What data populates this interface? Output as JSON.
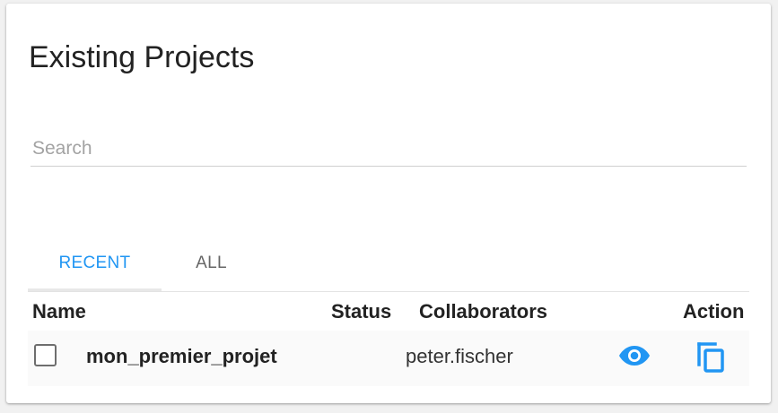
{
  "page": {
    "title": "Existing Projects"
  },
  "search": {
    "placeholder": "Search",
    "value": ""
  },
  "tabs": [
    {
      "label": "RECENT",
      "active": true
    },
    {
      "label": "ALL",
      "active": false
    }
  ],
  "table": {
    "headers": {
      "name": "Name",
      "status": "Status",
      "collaborators": "Collaborators",
      "action": "Action"
    },
    "rows": [
      {
        "name": "mon_premier_projet",
        "status": "",
        "collaborators": "peter.fischer",
        "checked": false,
        "actions": [
          "eye-icon",
          "copy-icon"
        ]
      }
    ]
  },
  "colors": {
    "accent": "#2196f3",
    "text": "#222222",
    "muted": "#a3a3a3"
  }
}
